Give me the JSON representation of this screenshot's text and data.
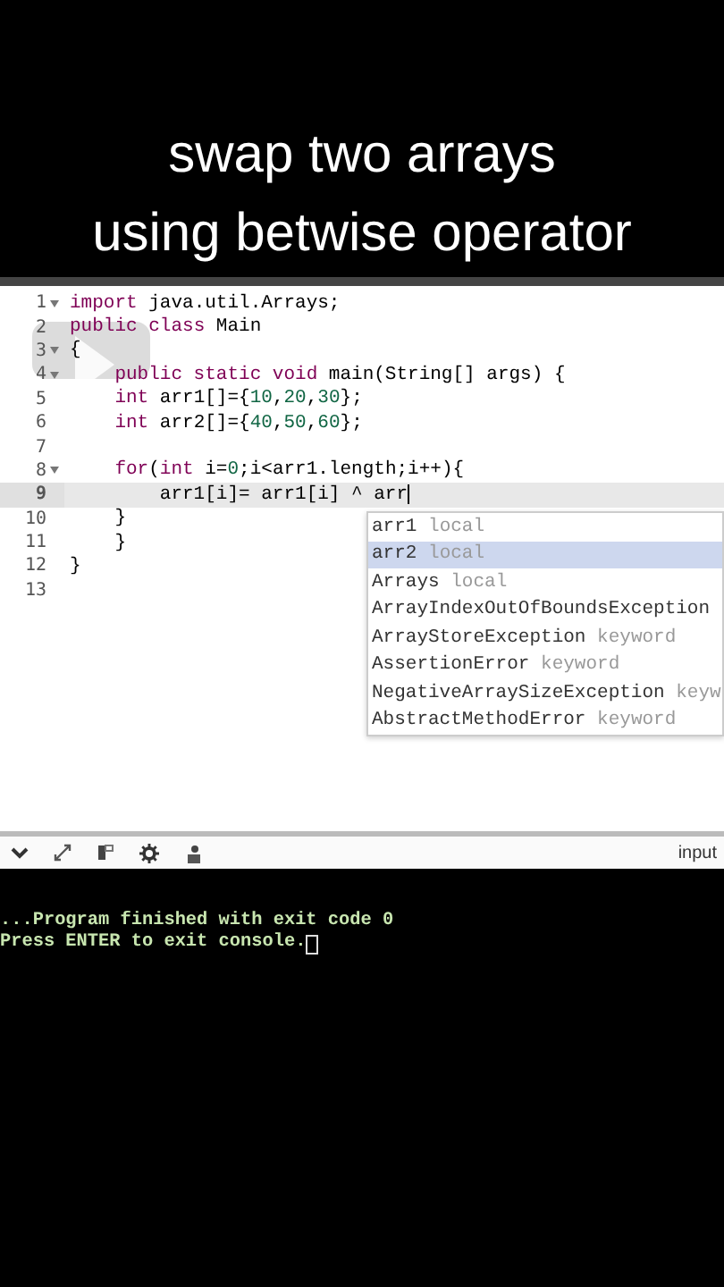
{
  "video_title": {
    "lines": [
      "swap two arrays",
      "using betwise operator"
    ]
  },
  "editor": {
    "lines": [
      {
        "number": "1",
        "foldable": true,
        "current": false,
        "tokens": [
          {
            "text": "import",
            "kind": "keyword"
          },
          {
            "text": " java.util.Arrays;",
            "kind": "plain"
          }
        ]
      },
      {
        "number": "2",
        "foldable": false,
        "current": false,
        "tokens": [
          {
            "text": "public",
            "kind": "keyword"
          },
          {
            "text": " class",
            "kind": "keyword"
          },
          {
            "text": " Main",
            "kind": "plain"
          }
        ]
      },
      {
        "number": "3",
        "foldable": true,
        "current": false,
        "tokens": [
          {
            "text": "{",
            "kind": "plain"
          }
        ]
      },
      {
        "number": "4",
        "foldable": true,
        "current": false,
        "tokens": [
          {
            "text": "    public static void",
            "kind": "keyword"
          },
          {
            "text": " main(String[] args) {",
            "kind": "plain"
          }
        ]
      },
      {
        "number": "5",
        "foldable": false,
        "current": false,
        "tokens": [
          {
            "text": "    int",
            "kind": "keyword"
          },
          {
            "text": " arr1[]={",
            "kind": "plain"
          },
          {
            "text": "10",
            "kind": "number"
          },
          {
            "text": ",",
            "kind": "plain"
          },
          {
            "text": "20",
            "kind": "number"
          },
          {
            "text": ",",
            "kind": "plain"
          },
          {
            "text": "30",
            "kind": "number"
          },
          {
            "text": "};",
            "kind": "plain"
          }
        ]
      },
      {
        "number": "6",
        "foldable": false,
        "current": false,
        "tokens": [
          {
            "text": "    int",
            "kind": "keyword"
          },
          {
            "text": " arr2[]={",
            "kind": "plain"
          },
          {
            "text": "40",
            "kind": "number"
          },
          {
            "text": ",",
            "kind": "plain"
          },
          {
            "text": "50",
            "kind": "number"
          },
          {
            "text": ",",
            "kind": "plain"
          },
          {
            "text": "60",
            "kind": "number"
          },
          {
            "text": "};",
            "kind": "plain"
          }
        ]
      },
      {
        "number": "7",
        "foldable": false,
        "current": false
      },
      {
        "number": "8",
        "foldable": true,
        "current": false,
        "tokens": [
          {
            "text": "    for",
            "kind": "keyword"
          },
          {
            "text": "(",
            "kind": "plain"
          },
          {
            "text": "int",
            "kind": "keyword"
          },
          {
            "text": " i=",
            "kind": "plain"
          },
          {
            "text": "0",
            "kind": "number"
          },
          {
            "text": ";i<arr1.length;i++){",
            "kind": "plain"
          }
        ]
      },
      {
        "number": "9",
        "foldable": false,
        "current": true,
        "tokens": [
          {
            "text": "        arr1[i]= arr1[i] ^ arr",
            "kind": "plain"
          }
        ]
      },
      {
        "number": "10",
        "foldable": false,
        "current": false,
        "tokens": [
          {
            "text": "    }",
            "kind": "plain"
          }
        ]
      },
      {
        "number": "11",
        "foldable": false,
        "current": false,
        "tokens": [
          {
            "text": "    }",
            "kind": "plain"
          }
        ]
      },
      {
        "number": "12",
        "foldable": false,
        "current": false,
        "tokens": [
          {
            "text": "}",
            "kind": "plain"
          }
        ]
      },
      {
        "number": "13",
        "foldable": false,
        "current": false
      }
    ]
  },
  "autocomplete": {
    "items": [
      {
        "name": "arr1",
        "type": "local",
        "selected": false
      },
      {
        "name": "arr2",
        "type": "local",
        "selected": true
      },
      {
        "name": "Arrays",
        "type": "local",
        "selected": false
      },
      {
        "name": "ArrayIndexOutOfBoundsException",
        "selected": false
      },
      {
        "name": "ArrayStoreException",
        "type": "keyword",
        "selected": false
      },
      {
        "name": "AssertionError",
        "type": "keyword",
        "selected": false
      },
      {
        "name": "NegativeArraySizeException",
        "type": "keyw",
        "selected": false
      },
      {
        "name": "AbstractMethodError",
        "type": "keyword",
        "selected": false
      }
    ]
  },
  "console_toolbar": {
    "input_label": "input"
  },
  "console": {
    "lines": [
      "...Program finished with exit code 0",
      "Press ENTER to exit console."
    ]
  }
}
